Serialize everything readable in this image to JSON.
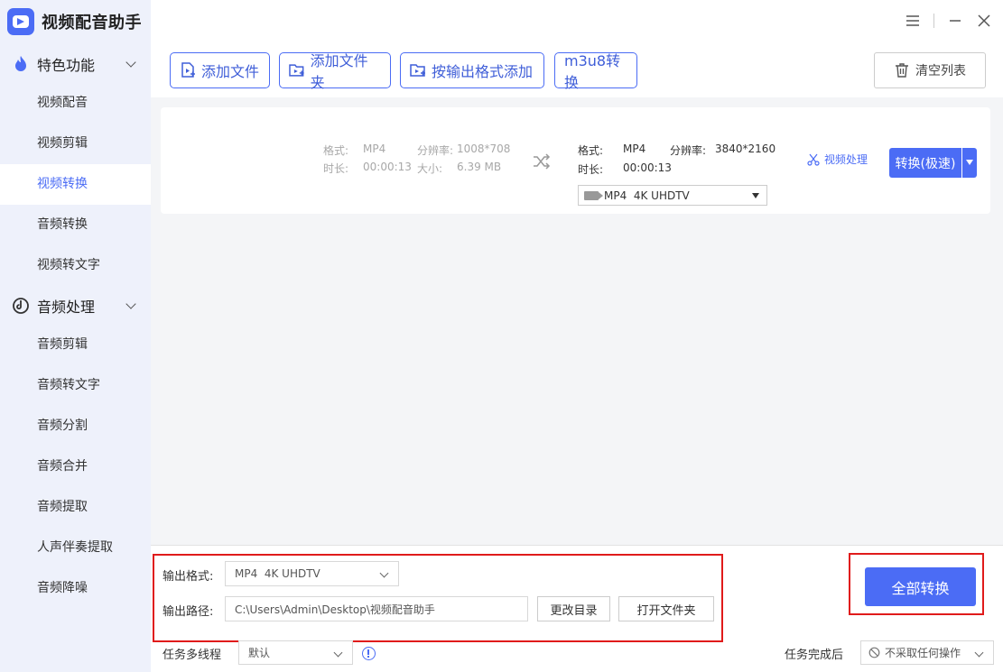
{
  "app": {
    "title": "视频配音助手"
  },
  "sidebar": {
    "sections": [
      {
        "label": "特色功能",
        "items": [
          {
            "label": "视频配音"
          },
          {
            "label": "视频剪辑"
          },
          {
            "label": "视频转换",
            "active": true
          },
          {
            "label": "音频转换"
          },
          {
            "label": "视频转文字"
          }
        ]
      },
      {
        "label": "音频处理",
        "items": [
          {
            "label": "音频剪辑"
          },
          {
            "label": "音频转文字"
          },
          {
            "label": "音频分割"
          },
          {
            "label": "音频合并"
          },
          {
            "label": "音频提取"
          },
          {
            "label": "人声伴奏提取"
          },
          {
            "label": "音频降噪"
          }
        ]
      }
    ]
  },
  "toolbar": {
    "add_file": "添加文件",
    "add_folder": "添加文件夹",
    "add_by_format": "按输出格式添加",
    "m3u8": "m3u8转换",
    "clear_list": "清空列表"
  },
  "file_item": {
    "source": {
      "format_label": "格式:",
      "format_value": "MP4",
      "resolution_label": "分辨率:",
      "resolution_value": "1008*708",
      "duration_label": "时长:",
      "duration_value": "00:00:13",
      "size_label": "大小:",
      "size_value": "6.39 MB"
    },
    "target": {
      "format_label": "格式:",
      "format_value": "MP4",
      "resolution_label": "分辨率:",
      "resolution_value": "3840*2160",
      "duration_label": "时长:",
      "duration_value": "00:00:13",
      "preset": "MP4  4K UHDTV"
    },
    "video_process": "视频处理",
    "convert_fast": "转换(极速)"
  },
  "bottom": {
    "output_format_label": "输出格式:",
    "output_format_value": "MP4  4K UHDTV",
    "output_path_label": "输出路径:",
    "output_path_value": "C:\\Users\\Admin\\Desktop\\视频配音助手",
    "change_dir": "更改目录",
    "open_folder": "打开文件夹",
    "convert_all": "全部转换",
    "multithread_label": "任务多线程",
    "multithread_value": "默认",
    "after_done_label": "任务完成后",
    "after_done_value": "不采取任何操作"
  },
  "colors": {
    "accent": "#4b6cf5",
    "highlight": "#e01b1b",
    "sidebar_bg": "#eef1fb"
  }
}
